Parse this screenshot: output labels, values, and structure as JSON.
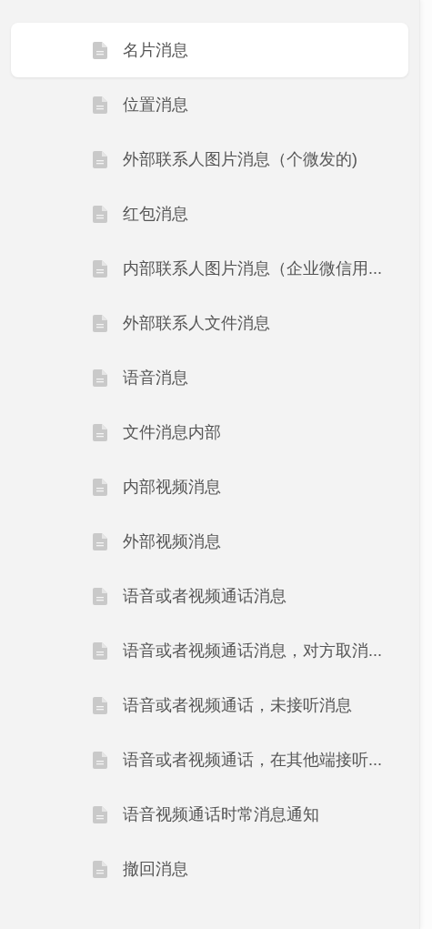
{
  "sidebar": {
    "items": [
      {
        "label": "名片消息",
        "selected": true
      },
      {
        "label": "位置消息",
        "selected": false
      },
      {
        "label": "外部联系人图片消息（个微发的)",
        "selected": false
      },
      {
        "label": "红包消息",
        "selected": false
      },
      {
        "label": "内部联系人图片消息（企业微信用...",
        "selected": false
      },
      {
        "label": "外部联系人文件消息",
        "selected": false
      },
      {
        "label": "语音消息",
        "selected": false
      },
      {
        "label": "文件消息内部",
        "selected": false
      },
      {
        "label": "内部视频消息",
        "selected": false
      },
      {
        "label": "外部视频消息",
        "selected": false
      },
      {
        "label": "语音或者视频通话消息",
        "selected": false
      },
      {
        "label": "语音或者视频通话消息，对方取消...",
        "selected": false
      },
      {
        "label": "语音或者视频通话，未接听消息",
        "selected": false
      },
      {
        "label": "语音或者视频通话，在其他端接听...",
        "selected": false
      },
      {
        "label": "语音视频通话时常消息通知",
        "selected": false
      },
      {
        "label": "撤回消息",
        "selected": false
      }
    ]
  }
}
